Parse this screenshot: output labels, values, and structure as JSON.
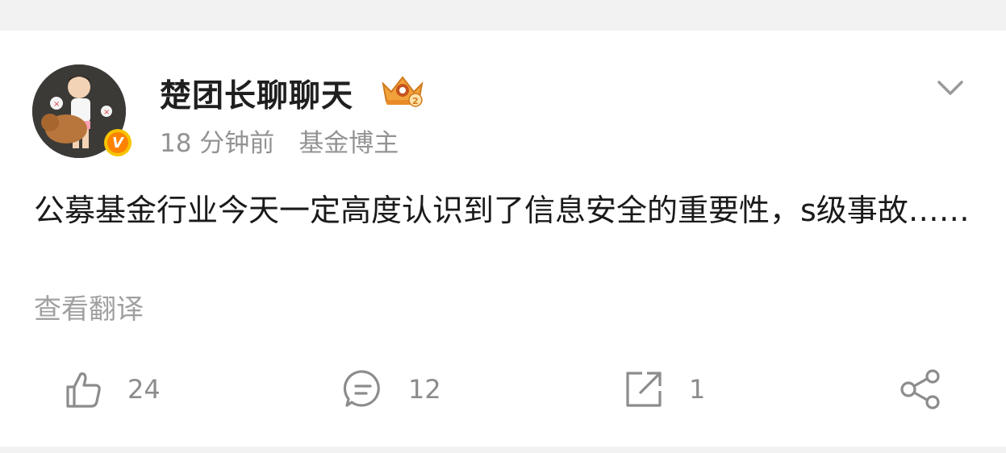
{
  "post": {
    "author": "楚团长聊聊天",
    "time": "18 分钟前",
    "tag": "基金博主",
    "verified_label": "V",
    "content": "公募基金行业今天一定高度认识到了信息安全的重要性，s级事故……",
    "translate_label": "查看翻译"
  },
  "actions": {
    "likes": "24",
    "comments": "12",
    "reposts": "1"
  },
  "icons": {
    "avatar": "avatar",
    "crown": "crown-badge-icon",
    "chevron": "chevron-down-icon",
    "like": "thumbs-up-icon",
    "comment": "comment-icon",
    "repost": "repost-icon",
    "share": "share-icon"
  },
  "colors": {
    "background": "#f2f2f2",
    "card": "#ffffff",
    "text": "#1a1a1a",
    "muted": "#939393",
    "badge": "#ff8200"
  }
}
